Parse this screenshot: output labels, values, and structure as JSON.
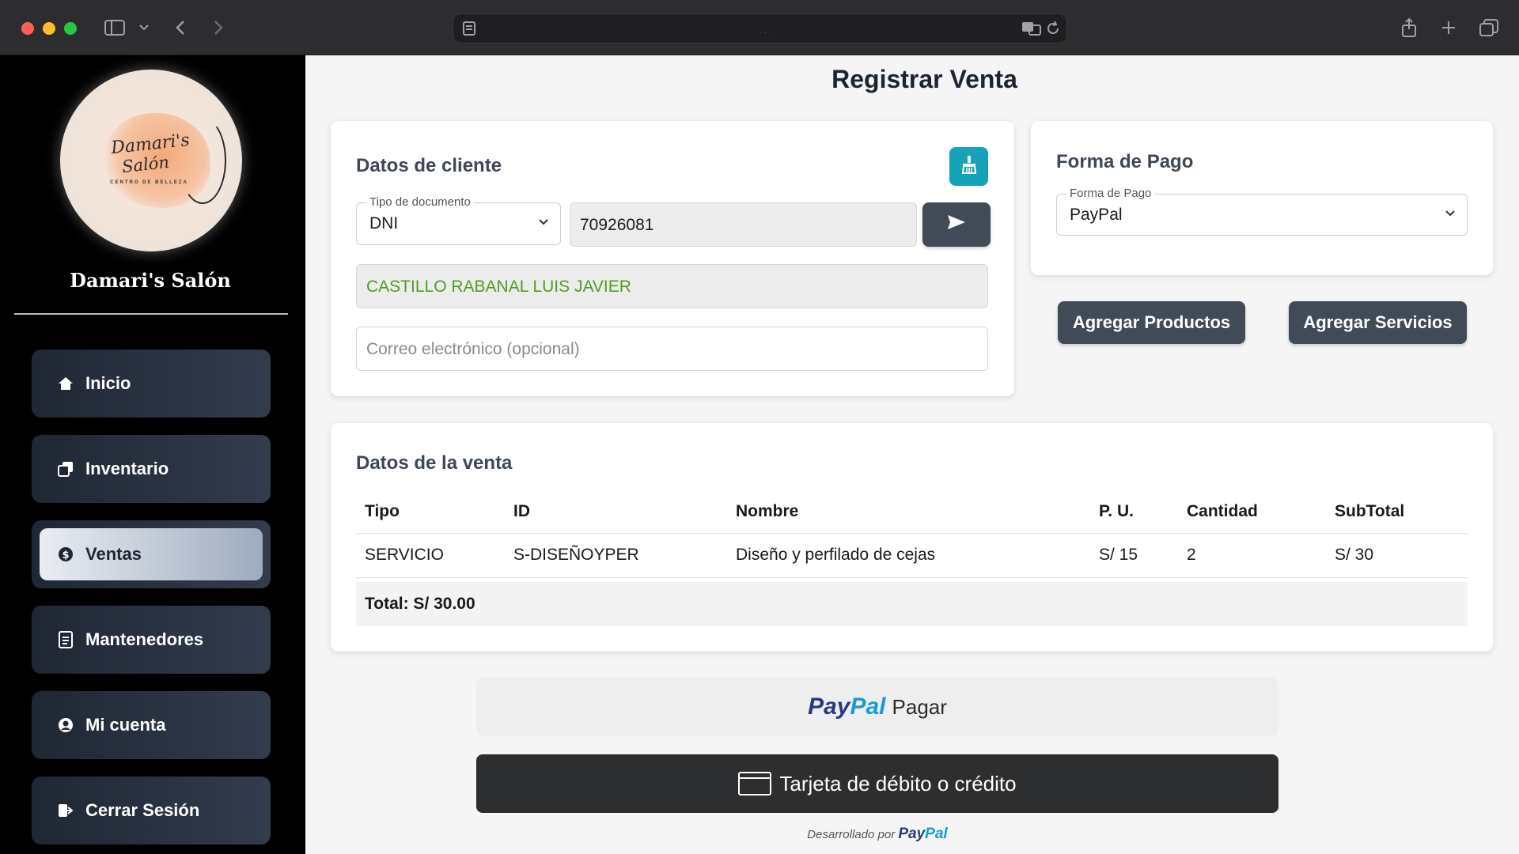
{
  "browser": {
    "address_dots": "· · ·"
  },
  "sidebar": {
    "brand": "Damari's Salón",
    "logo_line1": "Damari's",
    "logo_line2": "Salón",
    "logo_sub": "CENTRO DE BELLEZA",
    "items": [
      {
        "label": "Inicio",
        "icon": "home-icon",
        "active": false
      },
      {
        "label": "Inventario",
        "icon": "inventory-icon",
        "active": false
      },
      {
        "label": "Ventas",
        "icon": "sales-icon",
        "active": true
      },
      {
        "label": "Mantenedores",
        "icon": "document-icon",
        "active": false
      },
      {
        "label": "Mi cuenta",
        "icon": "user-icon",
        "active": false
      },
      {
        "label": "Cerrar Sesión",
        "icon": "logout-icon",
        "active": false
      }
    ]
  },
  "page": {
    "title": "Registrar Venta"
  },
  "client": {
    "title": "Datos de cliente",
    "doc_type_legend": "Tipo de documento",
    "doc_type_value": "DNI",
    "doc_number": "70926081",
    "client_name": "CASTILLO RABANAL LUIS JAVIER",
    "email_placeholder": "Correo electrónico (opcional)"
  },
  "payment": {
    "title": "Forma de Pago",
    "legend": "Forma de Pago",
    "value": "PayPal"
  },
  "actions": {
    "add_products": "Agregar Productos",
    "add_services": "Agregar Servicios"
  },
  "sale": {
    "title": "Datos de la venta",
    "columns": [
      "Tipo",
      "ID",
      "Nombre",
      "P. U.",
      "Cantidad",
      "SubTotal"
    ],
    "rows": [
      [
        "SERVICIO",
        "S-DISEÑOYPER",
        "Diseño y perfilado de cejas",
        "S/ 15",
        "2",
        "S/ 30"
      ]
    ],
    "total": "Total: S/ 30.00"
  },
  "paypal": {
    "logo_pay": "Pay",
    "logo_pal": "Pal",
    "pay_label": "Pagar",
    "card_label": "Tarjeta de débito o crédito",
    "powered_prefix": "Desarrollado por",
    "powered_brand_pay": "Pay",
    "powered_brand_pal": "Pal"
  },
  "colors": {
    "client_name": "#4f9d1f",
    "teal": "#16a2b8",
    "dark_button": "#414a57"
  }
}
